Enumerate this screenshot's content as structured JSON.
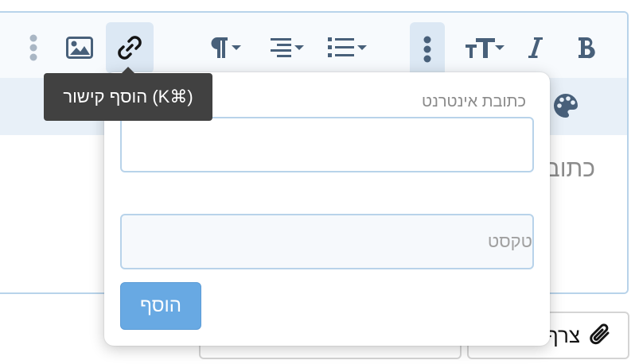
{
  "toolbar": {
    "buttons": [
      {
        "icon": "more-vertical-icon"
      },
      {
        "icon": "image-icon"
      },
      {
        "icon": "link-icon",
        "active": true
      },
      {
        "icon": "paragraph-icon"
      },
      {
        "icon": "align-icon"
      },
      {
        "icon": "list-icon"
      },
      {
        "icon": "more-vertical-icon"
      },
      {
        "icon": "text-size-icon"
      },
      {
        "icon": "italic-icon"
      },
      {
        "icon": "bold-icon"
      }
    ]
  },
  "subbar": {
    "icon": "palette-icon"
  },
  "editor": {
    "placeholder": "כתוב"
  },
  "tooltip": {
    "text": "הוסף קישור (K⌘)"
  },
  "link_popup": {
    "url_label": "כתובת אינטרנט",
    "url_value": "",
    "text_placeholder": "טקסט",
    "add_button_label": "הוסף"
  },
  "bottom_buttons": {
    "attach_label": "צרף",
    "attach_icon": "paperclip-icon"
  },
  "colors": {
    "accent": "#68a9e3",
    "toolbar_icon": "#48607a",
    "border": "#b8d3ea",
    "tooltip_bg": "#414141"
  }
}
